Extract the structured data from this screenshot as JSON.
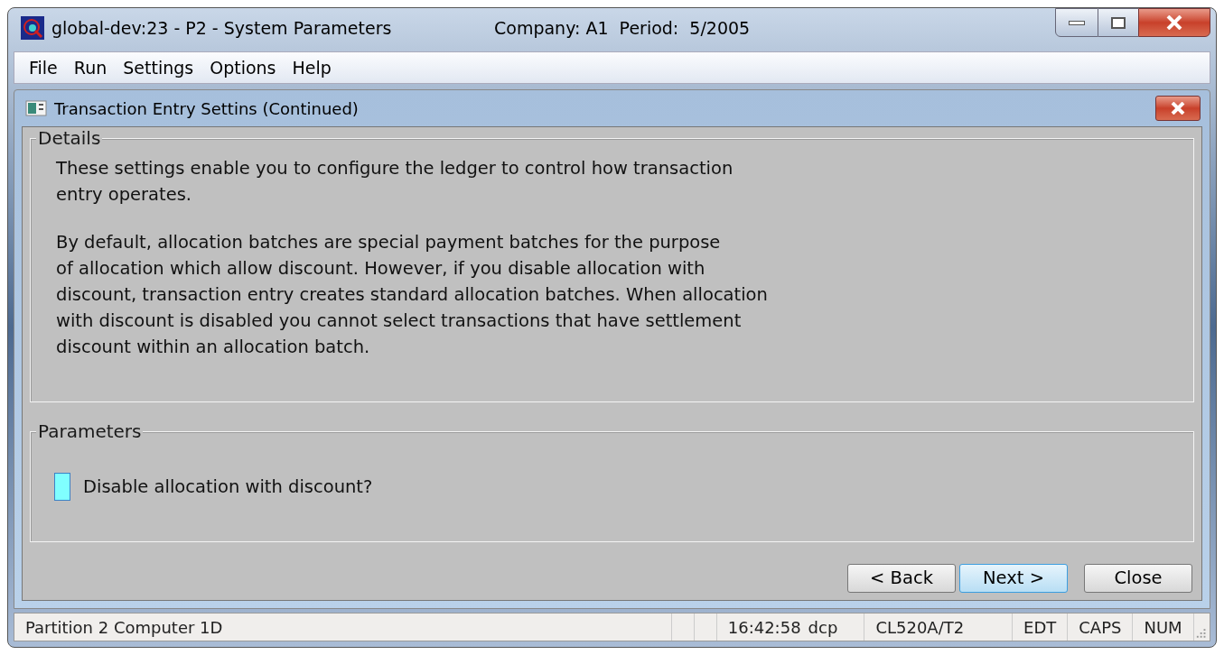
{
  "window": {
    "title": "global-dev:23 - P2 - System Parameters",
    "company": "Company: A1  Period:  5/2005"
  },
  "menu": [
    "File",
    "Run",
    "Settings",
    "Options",
    "Help"
  ],
  "dialog": {
    "title": "Transaction Entry Settins (Continued)",
    "details": {
      "legend": "Details",
      "paragraphs": [
        "These settings enable you to configure the ledger to control how transaction\nentry operates.",
        "By default, allocation batches are special payment batches for the purpose\nof allocation which allow discount. However, if you disable allocation with\ndiscount, transaction entry creates standard allocation batches. When allocation\nwith discount is disabled you cannot select transactions that have settlement\ndiscount within an allocation batch."
      ]
    },
    "parameters": {
      "legend": "Parameters",
      "options": [
        {
          "label": "Disable allocation with discount?",
          "checked": false
        }
      ]
    },
    "buttons": [
      {
        "label": "< Back",
        "default": false
      },
      {
        "label": "Next >",
        "default": true
      },
      {
        "label": "Close",
        "default": false
      }
    ]
  },
  "status_bar": {
    "cells": [
      {
        "texts": [
          "Partition 2 Computer 1D"
        ],
        "kind": "wide"
      },
      {
        "kind": "blank"
      },
      {
        "kind": "blank"
      },
      {
        "texts": [
          "16:42:58",
          "dcp"
        ],
        "kind": "fixed"
      },
      {
        "texts": [
          "CL520A/T2"
        ],
        "kind": "fixed"
      },
      {
        "texts": [
          "EDT"
        ],
        "kind": "small"
      },
      {
        "texts": [
          "CAPS"
        ],
        "kind": "small"
      },
      {
        "texts": [
          "NUM"
        ],
        "kind": "small"
      }
    ]
  }
}
